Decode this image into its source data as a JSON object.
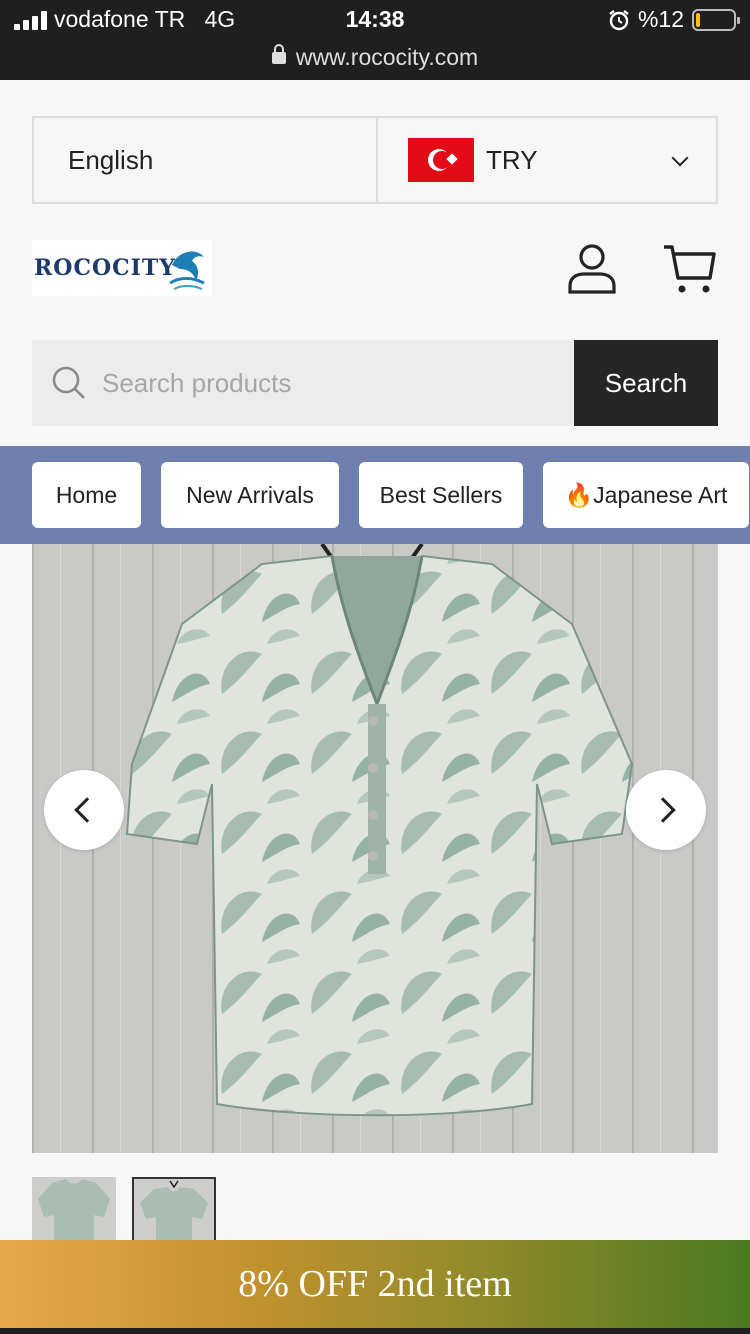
{
  "status_bar": {
    "carrier": "vodafone TR",
    "network": "4G",
    "time": "14:38",
    "battery": "%12",
    "battery_level": 0.12,
    "url": "www.rococity.com"
  },
  "selectors": {
    "language": "English",
    "currency": "TRY"
  },
  "logo": {
    "text": "ROCOCITY"
  },
  "search": {
    "placeholder": "Search products",
    "button_label": "Search"
  },
  "nav": {
    "items": [
      {
        "label": "Home"
      },
      {
        "label": "New Arrivals"
      },
      {
        "label": "Best Sellers"
      },
      {
        "label": "🔥Japanese Art"
      }
    ]
  },
  "promo": {
    "text": "8% OFF 2nd item"
  },
  "colors": {
    "status_bar_bg": "#1f1f1f",
    "nav_bg": "#6f7fb0",
    "search_button_bg": "#262626",
    "logo_color": "#1d3a6b",
    "promo_gradient_start": "#e8a848",
    "promo_gradient_end": "#4b7a1f"
  }
}
